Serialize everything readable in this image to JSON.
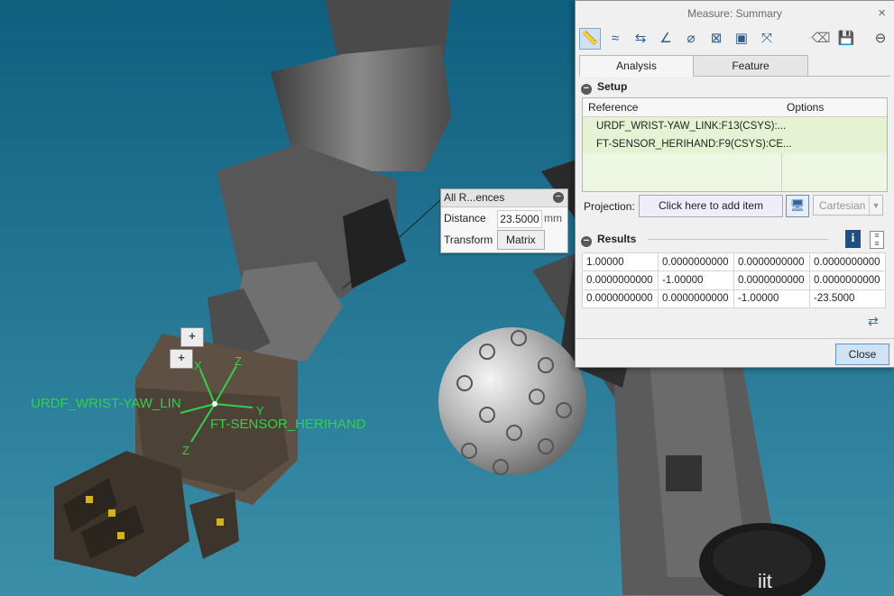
{
  "scene": {
    "labels": {
      "wrist_csys": "URDF_WRIST-YAW_LIN",
      "sensor_csys": "FT-SENSOR_HERIHAND"
    },
    "axis_labels": {
      "x": "X",
      "y": "Y",
      "z1": "Z",
      "z2": "Z"
    },
    "logo_text": "iit",
    "plus_buttons": [
      "+",
      "+"
    ]
  },
  "callout": {
    "title": "All R...ences",
    "distance_label": "Distance",
    "distance_value": "23.5000",
    "distance_unit": "mm",
    "transform_label": "Transform",
    "matrix_button": "Matrix"
  },
  "dialog": {
    "title": "Measure: Summary",
    "close_glyph": "×",
    "tools": [
      "ruler-icon",
      "length-curve-icon",
      "distance-icon",
      "angle-icon",
      "diameter-icon",
      "area-icon",
      "volume-icon",
      "transform-icon",
      "eraser-icon",
      "save-icon",
      "minimize-icon"
    ],
    "tabs": [
      "Analysis",
      "Feature"
    ],
    "setup_label": "Setup",
    "reference_header": "Reference",
    "options_header": "Options",
    "references": [
      "URDF_WRIST-YAW_LINK:F13(CSYS):...",
      "FT-SENSOR_HERIHAND:F9(CSYS):CE..."
    ],
    "projection_label": "Projection:",
    "projection_placeholder": "Click here to add item",
    "projection_mode": "Cartesian",
    "results_label": "Results",
    "matrix": [
      [
        "1.00000",
        "0.0000000000",
        "0.0000000000",
        "0.0000000000"
      ],
      [
        "0.0000000000",
        "-1.00000",
        "0.0000000000",
        "0.0000000000"
      ],
      [
        "0.0000000000",
        "0.0000000000",
        "-1.00000",
        "-23.5000"
      ]
    ],
    "close_label": "Close"
  },
  "colors": {
    "background_top": "#0f5f80",
    "background_bottom": "#3b8fa8",
    "csys_green": "#31d24a",
    "robot_gray": "#5a5a5a",
    "hand_brown": "#5e5143",
    "accent_blue": "#1d4f84"
  }
}
